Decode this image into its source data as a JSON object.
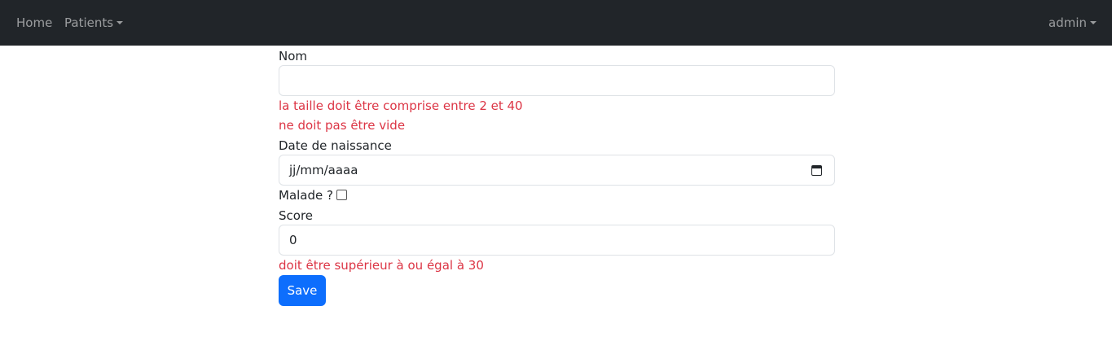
{
  "navbar": {
    "home_label": "Home",
    "patients_label": "Patients",
    "user_label": "admin"
  },
  "form": {
    "nom": {
      "label": "Nom",
      "value": "",
      "errors": [
        "la taille doit être comprise entre 2 et 40",
        "ne doit pas être vide"
      ]
    },
    "date_naissance": {
      "label": "Date de naissance",
      "placeholder": "jj/mm/aaaa",
      "icon": "calendar-icon"
    },
    "malade": {
      "label": "Malade ?",
      "checked": false
    },
    "score": {
      "label": "Score",
      "value": "0",
      "error": "doit être supérieur à ou égal à 30"
    },
    "save_label": "Save"
  },
  "colors": {
    "navbar_bg": "#212529",
    "error": "#dc3545",
    "primary": "#0d6efd"
  }
}
